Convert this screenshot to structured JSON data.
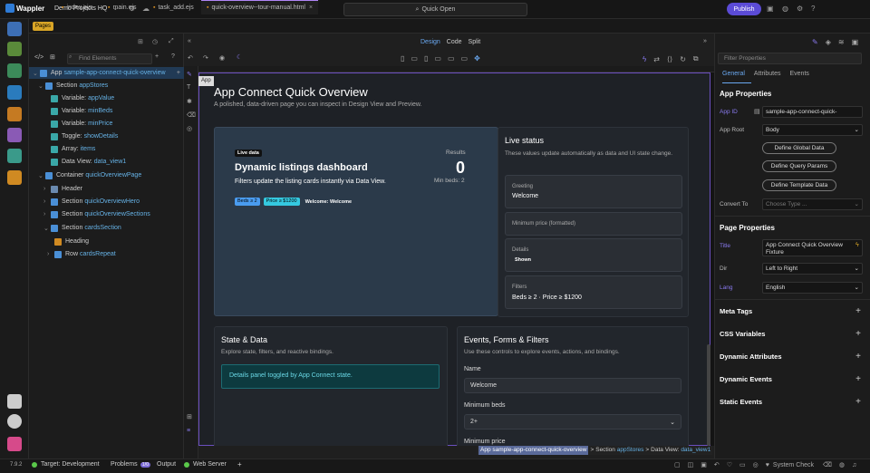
{
  "topbar": {
    "app": "Wappler",
    "project": "Demo Projects HQ",
    "quick_open": "Quick Open",
    "publish": "Publish"
  },
  "tabs": {
    "pages_badge": "Pages",
    "items": [
      "index.ejs",
      "main.ejs",
      "task_add.ejs",
      "quick-overview--tour-manual.html"
    ]
  },
  "view_modes": {
    "design": "Design",
    "code": "Code",
    "split": "Split"
  },
  "left": {
    "filter_placeholder": "Find Elements",
    "tree": [
      {
        "k": "App",
        "v": "sample-app-connect-quick-overview"
      },
      {
        "k": "Section",
        "v": "appStores"
      },
      {
        "k": "Variable:",
        "v": "appValue"
      },
      {
        "k": "Variable:",
        "v": "minBeds"
      },
      {
        "k": "Variable:",
        "v": "minPrice"
      },
      {
        "k": "Toggle:",
        "v": "showDetails"
      },
      {
        "k": "Array:",
        "v": "items"
      },
      {
        "k": "Data View:",
        "v": "data_view1"
      },
      {
        "k": "Container",
        "v": "quickOverviewPage"
      },
      {
        "k": "Header",
        "v": ""
      },
      {
        "k": "Section",
        "v": "quickOverviewHero"
      },
      {
        "k": "Section",
        "v": "quickOverviewSections"
      },
      {
        "k": "Section",
        "v": "cardsSection"
      },
      {
        "k": "Heading",
        "v": ""
      },
      {
        "k": "Row",
        "v": "cardsRepeat"
      }
    ]
  },
  "canvas": {
    "app_tag": "App",
    "title": "App Connect Quick Overview",
    "subtitle": "A polished, data-driven page you can inspect in Design View and Preview.",
    "hero": {
      "badge": "Live data",
      "title": "Dynamic listings dashboard",
      "desc": "Filters update the listing cards instantly via Data View.",
      "pill_beds": "Beds ≥ 2",
      "pill_price": "Price ≥ $1200",
      "welcome": "Welcome: Welcome",
      "results_label": "Results",
      "results_value": "0",
      "min_beds": "Min beds: 2"
    },
    "live": {
      "title": "Live status",
      "desc": "These values update automatically as data and UI state change.",
      "greeting_label": "Greeting",
      "greeting_value": "Welcome",
      "minprice_label": "Minimum price (formatted)",
      "details_label": "Details",
      "details_value": "Shown",
      "filters_label": "Filters",
      "filters_value": "Beds ≥ 2 · Price ≥ $1200"
    },
    "state": {
      "title": "State & Data",
      "desc": "Explore state, filters, and reactive bindings.",
      "alert": "Details panel toggled by App Connect state."
    },
    "events": {
      "title": "Events, Forms & Filters",
      "desc": "Use these controls to explore events, actions, and bindings.",
      "name_label": "Name",
      "name_value": "Welcome",
      "beds_label": "Minimum beds",
      "beds_value": "2+",
      "price_label": "Minimum price"
    },
    "breadcrumb": {
      "app": "App",
      "app_name": "sample-app-connect-quick-overview",
      "section": "Section",
      "section_name": "appStores",
      "dataview": "Data View:",
      "dataview_name": "data_view1"
    }
  },
  "right": {
    "filter_placeholder": "Filter Properties",
    "tabs": [
      "General",
      "Attributes",
      "Events"
    ],
    "app_props": "App Properties",
    "app_id_label": "App ID",
    "app_id_value": "sample-app-connect-quick-overview",
    "app_root_label": "App Root",
    "app_root_value": "Body",
    "btn_global": "Define Global Data",
    "btn_query": "Define Query Params",
    "btn_template": "Define Template Data",
    "convert_label": "Convert To",
    "convert_placeholder": "Choose Type ...",
    "page_props": "Page Properties",
    "title_label": "Title",
    "title_value": "App Connect Quick Overview Fixture",
    "dir_label": "Dir",
    "dir_value": "Left to Right",
    "lang_label": "Lang",
    "lang_value": "English",
    "sections": [
      "Meta Tags",
      "CSS Variables",
      "Dynamic Attributes",
      "Dynamic Events",
      "Static Events"
    ]
  },
  "status": {
    "version": "7.9.2",
    "target": "Target: Development",
    "problems": "Problems",
    "problems_count": "1/0",
    "output": "Output",
    "webserver": "Web Server",
    "syscheck": "System Check"
  }
}
